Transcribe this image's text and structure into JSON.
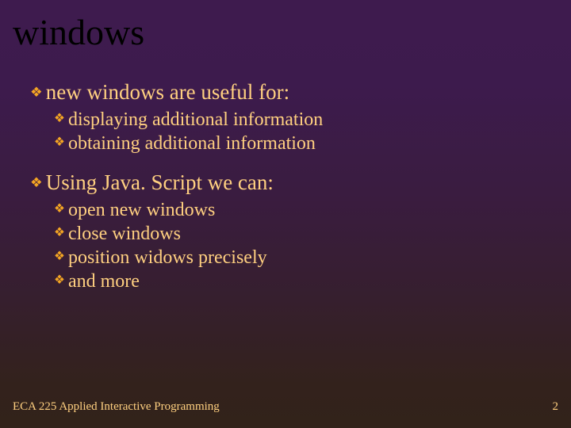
{
  "title": "windows",
  "bullets": {
    "b1": "new windows are useful for:",
    "b1a": "displaying additional information",
    "b1b": "obtaining additional information",
    "b2": "Using Java. Script we can:",
    "b2a": "open new windows",
    "b2b": "close windows",
    "b2c": "position widows precisely",
    "b2d": "and more"
  },
  "footer": {
    "left": "ECA 225   Applied Interactive Programming",
    "right": "2"
  }
}
